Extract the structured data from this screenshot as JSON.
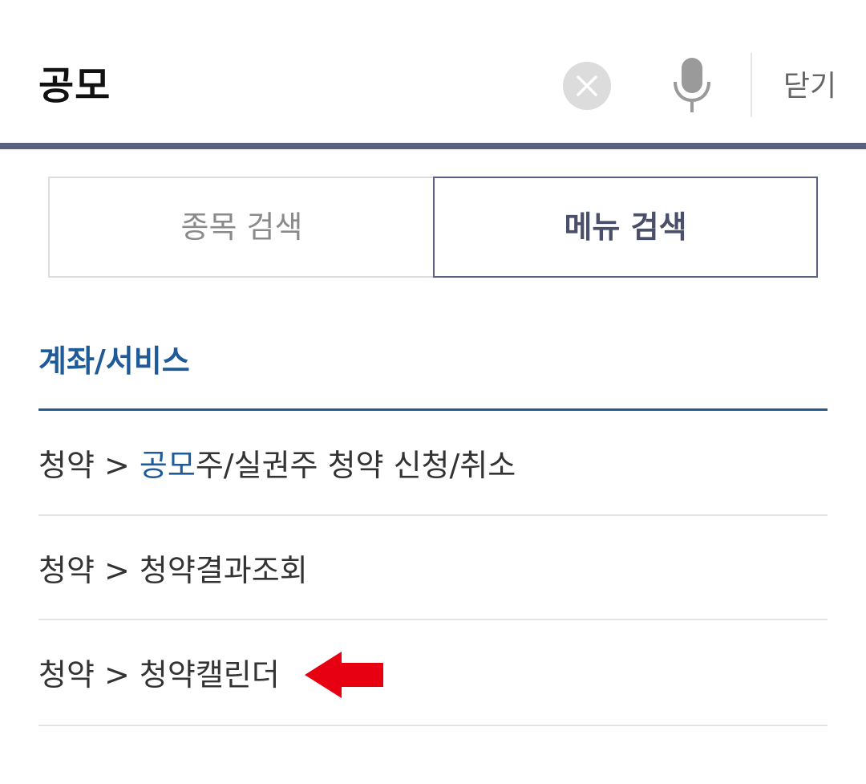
{
  "search": {
    "query": "공모",
    "close_label": "닫기"
  },
  "tabs": {
    "stock": "종목 검색",
    "menu": "메뉴 검색",
    "active": "menu"
  },
  "section": {
    "title": "계좌/서비스"
  },
  "results": [
    {
      "category": "청약",
      "sep": " > ",
      "before": "",
      "match": "공모",
      "after": "주/실권주 청약 신청/취소"
    },
    {
      "category": "청약",
      "sep": " > ",
      "before": "청약결과조회",
      "match": "",
      "after": ""
    },
    {
      "category": "청약",
      "sep": " > ",
      "before": "청약캘린더",
      "match": "",
      "after": ""
    }
  ],
  "icons": {
    "clear": "clear-icon",
    "mic": "microphone-icon",
    "annotation": "arrow-left-icon"
  },
  "colors": {
    "accent": "#1f5a99",
    "header_bar": "#5a6080",
    "arrow": "#e60012"
  }
}
